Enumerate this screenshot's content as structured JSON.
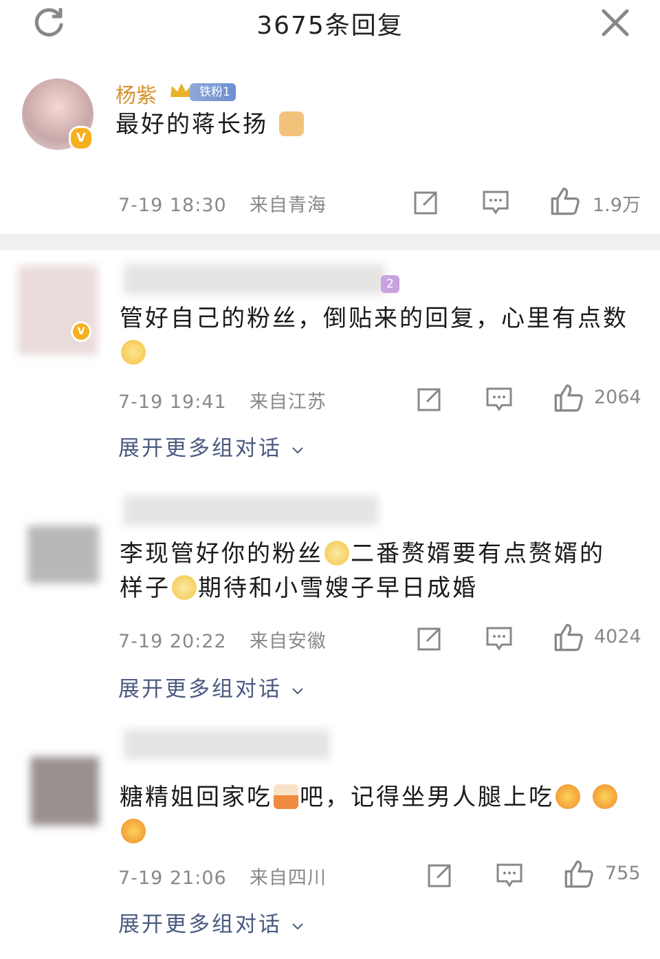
{
  "header": {
    "title": "3675条回复",
    "refresh_icon": "refresh-icon",
    "close_icon": "close-icon"
  },
  "colors": {
    "accent_name": "#d4922e",
    "meta": "#888888",
    "link": "#4a5a80",
    "badge": "#f6b01e"
  },
  "comments": [
    {
      "name": "杨紫",
      "fan_badge": "铁粉1",
      "text": "最好的蒋长扬",
      "emoji": [
        "victory-hand-emoji"
      ],
      "time": "7-19 18:30",
      "location": "来自青海",
      "likes": "1.9万"
    },
    {
      "badge_partial": "2",
      "text": "管好自己的粉丝，倒贴来的回复，心里有点数",
      "emoji": [
        "smile-emoji"
      ],
      "time": "7-19 19:41",
      "location": "来自江苏",
      "likes": "2064",
      "expand": "展开更多组对话"
    },
    {
      "text_part1": "李现管好你的粉丝",
      "text_part2": "二番赘婿要有点赘婿的样子",
      "text_part3": "期待和小雪嫂子早日成婚",
      "emoji": [
        "flower-emoji",
        "flower-emoji"
      ],
      "time": "7-19 20:22",
      "location": "来自安徽",
      "likes": "4024",
      "expand": "展开更多组对话"
    },
    {
      "text_part1": "糖精姐回家吃",
      "text_part2": "吧，记得坐男人腿上吃",
      "emoji": [
        "cake-emoji",
        "laugh-emoji",
        "laugh-emoji",
        "laugh-emoji"
      ],
      "time": "7-19 21:06",
      "location": "来自四川",
      "likes": "755",
      "expand": "展开更多组对话"
    }
  ],
  "actions": {
    "share_icon": "share-icon",
    "reply_icon": "comment-icon",
    "like_icon": "thumbs-up-icon"
  }
}
